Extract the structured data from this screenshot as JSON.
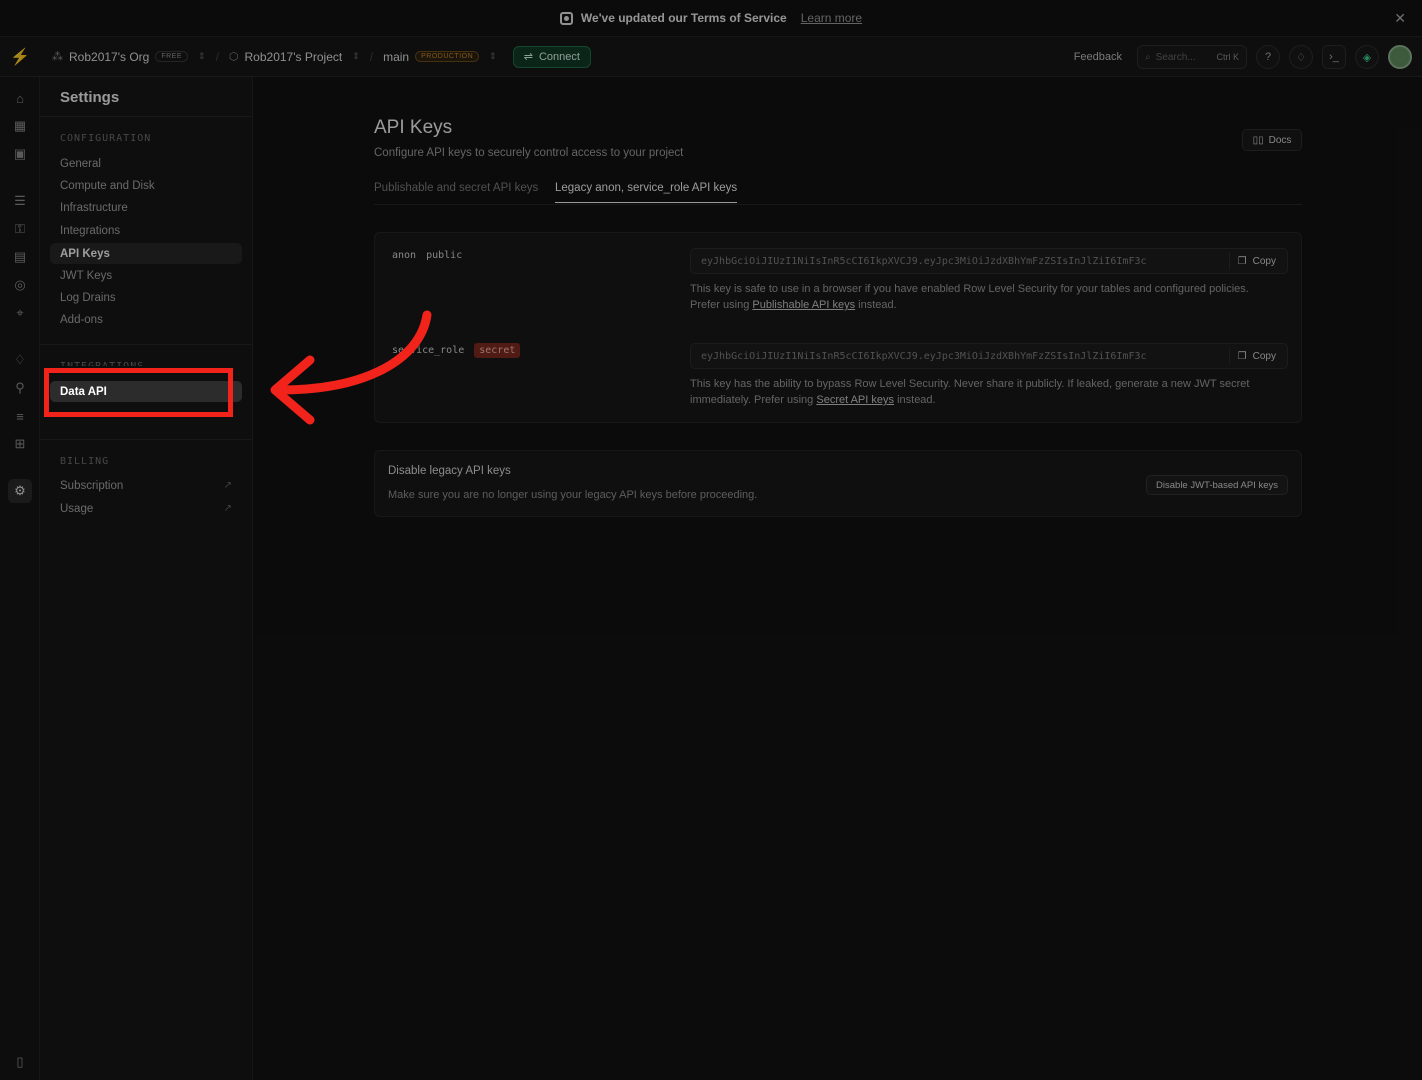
{
  "banner": {
    "text": "We've updated our Terms of Service",
    "link": "Learn more",
    "close": "✕"
  },
  "topbar": {
    "org": "Rob2017's Org",
    "org_badge": "FREE",
    "project": "Rob2017's Project",
    "branch": "main",
    "branch_badge": "PRODUCTION",
    "connect": "Connect",
    "feedback": "Feedback",
    "search_placeholder": "Search...",
    "search_shortcut": "Ctrl K"
  },
  "sidebar": {
    "title": "Settings",
    "configuration_label": "CONFIGURATION",
    "configuration_items": [
      "General",
      "Compute and Disk",
      "Infrastructure",
      "Integrations",
      "API Keys",
      "JWT Keys",
      "Log Drains",
      "Add-ons"
    ],
    "integrations_label": "INTEGRATIONS",
    "data_api": "Data API",
    "billing_label": "BILLING",
    "billing_items": [
      "Subscription",
      "Usage"
    ]
  },
  "main": {
    "title": "API Keys",
    "subtitle": "Configure API keys to securely control access to your project",
    "docs": "Docs",
    "tabs": [
      "Publishable and secret API keys",
      "Legacy anon, service_role API keys"
    ],
    "anon": {
      "name": "anon",
      "tag": "public",
      "key": "eyJhbGciOiJIUzI1NiIsInR5cCI6IkpXVCJ9.eyJpc3MiOiJzdXBhYmFzZSIsInJlZiI6ImF3c",
      "copy": "Copy",
      "desc_1": "This key is safe to use in a browser if you have enabled Row Level Security for your tables and configured policies.",
      "desc_2a": "Prefer using ",
      "desc_link": "Publishable API keys",
      "desc_2b": " instead."
    },
    "service": {
      "name": "service_role",
      "tag": "secret",
      "key": "eyJhbGciOiJIUzI1NiIsInR5cCI6IkpXVCJ9.eyJpc3MiOiJzdXBhYmFzZSIsInJlZiI6ImF3c",
      "copy": "Copy",
      "desc_1": "This key has the ability to bypass Row Level Security. Never share it publicly. If leaked, generate a new JWT secret",
      "desc_2a": "immediately. Prefer using ",
      "desc_link": "Secret API keys",
      "desc_2b": " instead."
    },
    "disable": {
      "title": "Disable legacy API keys",
      "desc": "Make sure you are no longer using your legacy API keys before proceeding.",
      "button": "Disable JWT-based API keys"
    }
  },
  "colors": {
    "accent": "#3ecf8e",
    "annotation": "#f2231b",
    "secret_badge": "#7a2a20"
  }
}
